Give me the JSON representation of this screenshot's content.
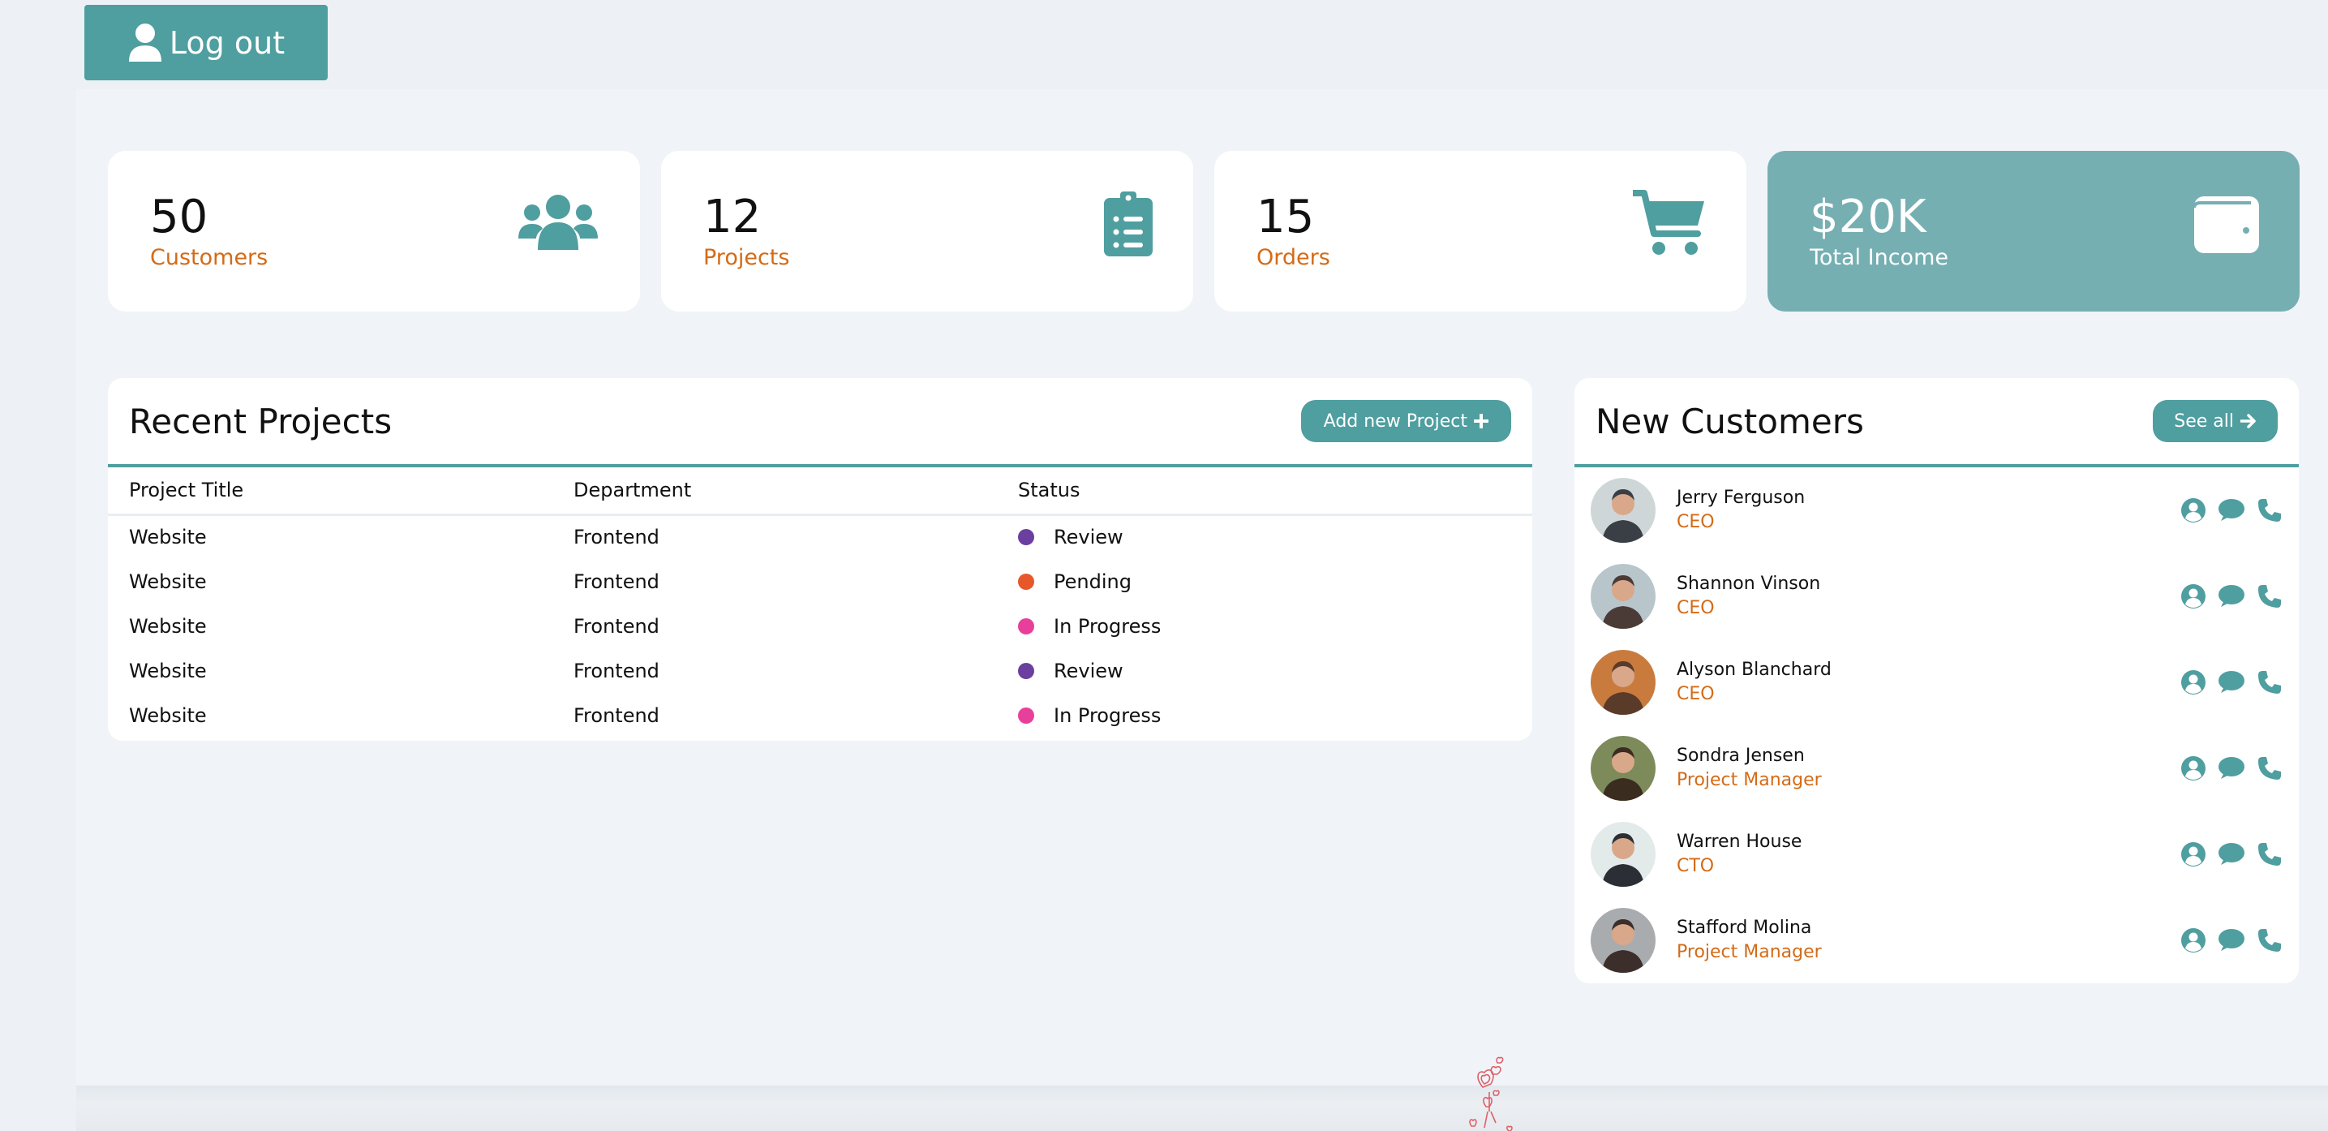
{
  "header": {
    "logout_label": "Log out"
  },
  "stats": [
    {
      "value": "50",
      "label": "Customers",
      "icon": "users-icon"
    },
    {
      "value": "12",
      "label": "Projects",
      "icon": "clipboard-list-icon"
    },
    {
      "value": "15",
      "label": "Orders",
      "icon": "shopping-cart-icon"
    },
    {
      "value": "$20K",
      "label": "Total Income",
      "icon": "wallet-icon"
    }
  ],
  "recent_projects": {
    "title": "Recent Projects",
    "add_button": "Add new Project",
    "columns": [
      "Project Title",
      "Department",
      "Status"
    ],
    "rows": [
      {
        "title": "Website",
        "department": "Frontend",
        "status": "Review",
        "status_color": "#6a3fa0"
      },
      {
        "title": "Website",
        "department": "Frontend",
        "status": "Pending",
        "status_color": "#e8572a"
      },
      {
        "title": "Website",
        "department": "Frontend",
        "status": "In Progress",
        "status_color": "#e8409a"
      },
      {
        "title": "Website",
        "department": "Frontend",
        "status": "Review",
        "status_color": "#6a3fa0"
      },
      {
        "title": "Website",
        "department": "Frontend",
        "status": "In Progress",
        "status_color": "#e8409a"
      }
    ]
  },
  "new_customers": {
    "title": "New Customers",
    "see_all": "See all",
    "items": [
      {
        "name": "Jerry Ferguson",
        "role": "CEO"
      },
      {
        "name": "Shannon Vinson",
        "role": "CEO"
      },
      {
        "name": "Alyson Blanchard",
        "role": "CEO"
      },
      {
        "name": "Sondra Jensen",
        "role": "Project Manager"
      },
      {
        "name": "Warren House",
        "role": "CTO"
      },
      {
        "name": "Stafford Molina",
        "role": "Project Manager"
      }
    ]
  },
  "colors": {
    "primary": "#4f9ea0",
    "accent_card": "#76afb2",
    "label_orange": "#d46b17",
    "background": "#f0f4f8"
  }
}
